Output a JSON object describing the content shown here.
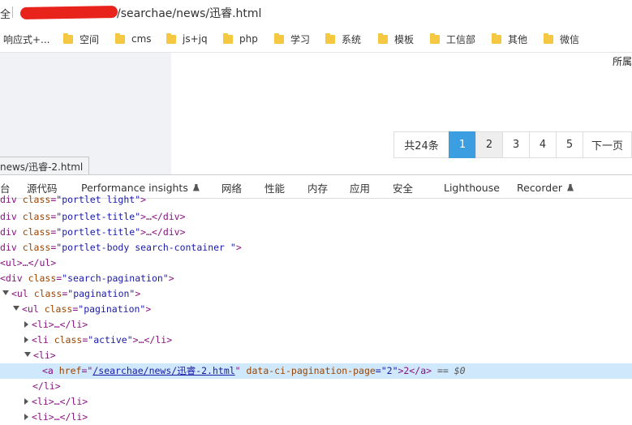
{
  "address_bar": {
    "lead_text": "全",
    "url_suffix": "/searchae/news/迅睿.html"
  },
  "bookmarks": {
    "items": [
      {
        "label": "响应式+...",
        "has_folder": false
      },
      {
        "label": "空间",
        "has_folder": true
      },
      {
        "label": "cms",
        "has_folder": true
      },
      {
        "label": "js+jq",
        "has_folder": true
      },
      {
        "label": "php",
        "has_folder": true
      },
      {
        "label": "学习",
        "has_folder": true
      },
      {
        "label": "系统",
        "has_folder": true
      },
      {
        "label": "模板",
        "has_folder": true
      },
      {
        "label": "工信部",
        "has_folder": true
      },
      {
        "label": "其他",
        "has_folder": true
      },
      {
        "label": "微信",
        "has_folder": true
      }
    ]
  },
  "page": {
    "corner_text": "所属",
    "pagination": {
      "total_label": "共24条",
      "pages": [
        "1",
        "2",
        "3",
        "4",
        "5"
      ],
      "active_page": "1",
      "hover_page": "2",
      "next_label": "下一页"
    }
  },
  "tooltip": {
    "text": "news/迅睿-2.html"
  },
  "devtools": {
    "tabs": [
      {
        "label": "台",
        "experimental": false
      },
      {
        "label": "源代码",
        "experimental": false
      },
      {
        "label": "Performance insights",
        "experimental": true
      },
      {
        "label": "网络",
        "experimental": false
      },
      {
        "label": "性能",
        "experimental": false
      },
      {
        "label": "内存",
        "experimental": false
      },
      {
        "label": "应用",
        "experimental": false
      },
      {
        "label": "安全",
        "experimental": false
      },
      {
        "label": "Lighthouse",
        "experimental": false
      },
      {
        "label": "Recorder",
        "experimental": true
      }
    ],
    "tree": {
      "l0": {
        "open": "div ",
        "attr": "class",
        "val": "\"portlet light\"",
        "close": ">"
      },
      "l1": {
        "open": "div ",
        "attr": "class",
        "val": "\"portlet-title\"",
        "close": ">…</div>"
      },
      "l2": {
        "open": "div ",
        "attr": "class",
        "val": "\"portlet-title\"",
        "close": ">…</div>"
      },
      "l3": {
        "open": "div ",
        "attr": "class",
        "val": "\"portlet-body search-container \"",
        "close": ">"
      },
      "l4": {
        "text": "<ul>…</ul>"
      },
      "l5": {
        "open": "<div ",
        "attr": "class",
        "val": "\"search-pagination\"",
        "close": ">"
      },
      "l6": {
        "open": "<ul ",
        "attr": "class",
        "val": "\"pagination\"",
        "close": ">"
      },
      "l7": {
        "open": "<ul ",
        "attr": "class",
        "val": "\"pagination\"",
        "close": ">"
      },
      "l8": {
        "text": "<li>…</li>"
      },
      "l9": {
        "open": "<li ",
        "attr": "class",
        "val": "\"active\"",
        "close": ">…</li>"
      },
      "l10": {
        "text": "<li>"
      },
      "l11": {
        "open": "<a ",
        "href_attr": "href",
        "href_q1": "=\"",
        "href_val": "/searchae/news/迅睿-2.html",
        "href_q2": "\"",
        "data_attr": "data-ci-pagination-page",
        "data_val": "=\"2\"",
        "text_content": ">2</a>",
        "marker": "== $0"
      },
      "l12": {
        "text": "</li>"
      },
      "l13": {
        "text": "<li>…</li>"
      },
      "l14": {
        "text": "<li>…</li>"
      }
    }
  },
  "colors": {
    "active_page_bg": "#3a9ee0",
    "selected_row_bg": "#cfe8fc",
    "redaction": "#e8231c",
    "folder": "#f5c842"
  }
}
